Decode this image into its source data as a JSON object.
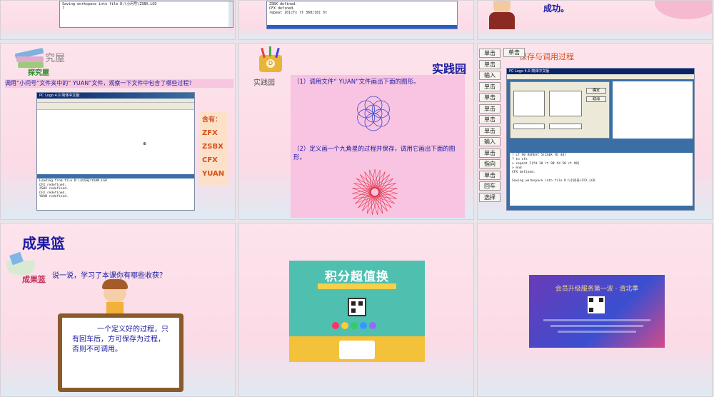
{
  "slide1": {
    "log_line": "Saving workspace into file D:\\小问号\\ZSBX.LGO",
    "prompt": "?"
  },
  "slide2": {
    "lines": [
      "ZSBX defined.",
      "CFX defined.",
      "repeat 10[cfx rt 360/10] ht"
    ]
  },
  "slide3": {
    "text": "成功。"
  },
  "slide4": {
    "heading": "探究屋",
    "heading_top": "究屋",
    "instruction": "调用“小问号”文件夹中的“ YUAN”文件，观察一下文件中包含了哪些过程？",
    "window_title": "PC Logo 4.0 简体中文版 ",
    "console_lines": [
      "Loading from file D:\\小问号\\YUAN.LGO",
      "CFX redefined.",
      "ZSBX redefined.",
      "CFX redefined.",
      "YUAN redefined."
    ],
    "contains_label": "含有：",
    "contains_items": [
      "ZFX",
      "ZSBX",
      "CFX",
      "YUAN"
    ]
  },
  "slide5": {
    "title": "实践园",
    "logo_caption": "实践园",
    "task1": "（1）调用文件“ YUAN”文件画出下面的图形。",
    "task2": "（2）定义画一个九角星的过程并保存，调用它画出下面的图形。"
  },
  "slide6": {
    "heading": "保存与调用过程",
    "side_buttons": [
      "单击",
      "单击",
      "输入",
      "单击",
      "单击",
      "单击",
      "单击",
      "单击",
      "输入",
      "单击",
      "指向",
      "单击",
      "回车",
      "选择"
    ],
    "top_button": "单击",
    "window_title": "PC Logo 4.0 简体中文版",
    "console_lines": [
      "? LT 90 REPEAT 5[ZSBX FD 40]",
      "? to cfx",
      "> repeat 2[fd 10 rt 90 fd 50 rt 90]",
      "> end",
      "CFX defined.",
      "",
      "Saving workspace into file D:\\小问号\\CFX.LGO"
    ],
    "dialog_ok": "确定",
    "dialog_cancel": "取消"
  },
  "slide7": {
    "title": "成果篮",
    "logo_caption": "成果篮",
    "question": "说一说，学习了本课你有哪些收获？",
    "board_text": "一个定义好的过程，只有回车后，方可保存为过程，否则不可调用。"
  },
  "slide8": {
    "banner_title": "积分超值换"
  },
  "slide9": {
    "banner_title": "会员升级服务第一波 · 清北季"
  },
  "colors": {
    "pink_bg": "#fde3ec",
    "blue_text": "#1a1aa0",
    "orange": "#d4501e"
  }
}
